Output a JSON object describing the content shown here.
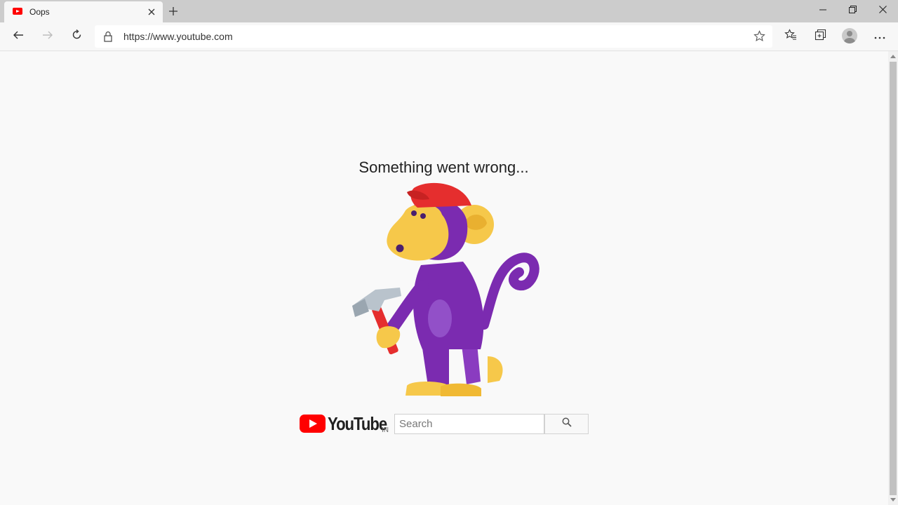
{
  "browser": {
    "tab": {
      "title": "Oops",
      "favicon": "youtube-favicon-icon"
    },
    "address_bar": {
      "url": "https://www.youtube.com"
    },
    "toolbar_icons": [
      "back-icon",
      "forward-icon",
      "refresh-icon",
      "lock-icon",
      "star-icon",
      "favorites-icon",
      "collections-icon",
      "profile-avatar",
      "more-icon"
    ],
    "window_controls": [
      "minimize-icon",
      "restore-icon",
      "close-icon"
    ]
  },
  "page": {
    "message": "Something went wrong...",
    "illustration": "monkey-with-hammer",
    "logo": {
      "wordmark": "YouTube",
      "country": "IN"
    },
    "search": {
      "placeholder": "Search",
      "value": ""
    }
  },
  "colors": {
    "brand_red": "#ff0000",
    "monkey_purple": "#7b2bb0",
    "monkey_face": "#f6c84a",
    "cap_red": "#e52e2e",
    "page_background": "#f9f9f9"
  }
}
